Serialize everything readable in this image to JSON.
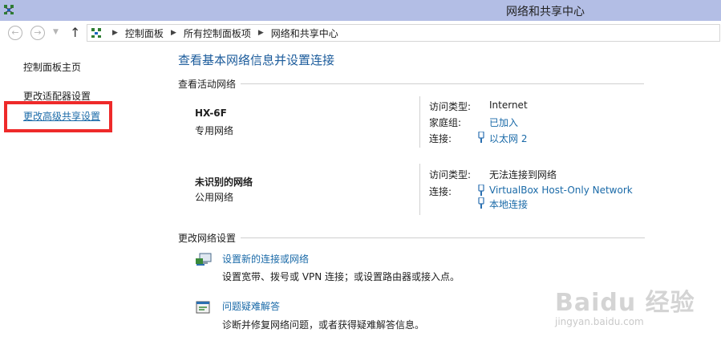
{
  "window": {
    "title": "网络和共享中心",
    "icon": "network-icon"
  },
  "navigation": {
    "back_icon": "back-arrow-icon",
    "forward_icon": "forward-arrow-icon",
    "dropdown_icon": "chevron-down-icon",
    "up_icon": "up-arrow-icon",
    "breadcrumb": [
      "控制面板",
      "所有控制面板项",
      "网络和共享中心"
    ]
  },
  "sidebar": {
    "home": "控制面板主页",
    "adapter": "更改适配器设置",
    "sharing": "更改高级共享设置",
    "highlight_color": "#ee2a2a"
  },
  "main": {
    "title": "查看基本网络信息并设置连接",
    "active_section": "查看活动网络",
    "networks": [
      {
        "name": "HX-6F",
        "type": "专用网络",
        "props": [
          {
            "label": "访问类型:",
            "value": "Internet"
          },
          {
            "label": "家庭组:",
            "value": "已加入"
          },
          {
            "label": "连接:",
            "value": "以太网 2"
          }
        ]
      },
      {
        "name": "未识别的网络",
        "type": "公用网络",
        "props": [
          {
            "label": "访问类型:",
            "value": "无法连接到网络"
          },
          {
            "label": "连接:",
            "value": "VirtualBox Host-Only Network"
          },
          {
            "label": "",
            "value": "本地连接"
          }
        ]
      }
    ],
    "change_section": "更改网络设置",
    "tasks": [
      {
        "link": "设置新的连接或网络",
        "desc": "设置宽带、拨号或 VPN 连接；或设置路由器或接入点。"
      },
      {
        "link": "问题疑难解答",
        "desc": "诊断并修复网络问题，或者获得疑难解答信息。"
      }
    ]
  },
  "watermark": {
    "main": "Baidu 经验",
    "sub": "jingyan.baidu.com"
  },
  "colors": {
    "title_bar": "#b3bee5",
    "link": "#1a6aa8",
    "heading": "#1b5b9b"
  }
}
